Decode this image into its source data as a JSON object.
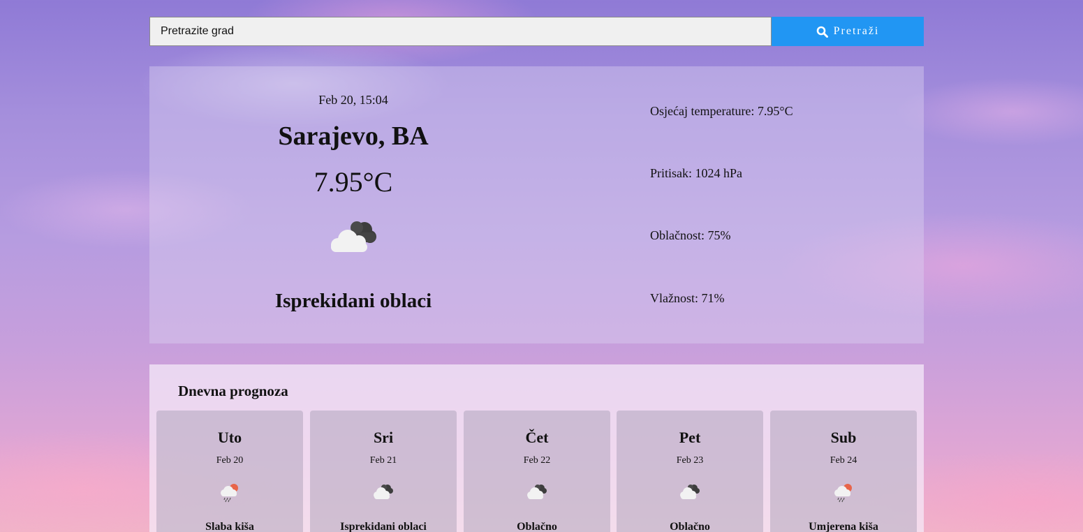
{
  "search": {
    "placeholder": "Pretrazite grad",
    "button_label": "Pretraži"
  },
  "current": {
    "date": "Feb 20, 15:04",
    "city": "Sarajevo, BA",
    "temperature": "7.95°C",
    "icon": "broken-clouds-icon",
    "description": "Isprekidani oblaci",
    "details": {
      "feels_like": "Osjećaj temperature: 7.95°C",
      "pressure": "Pritisak: 1024 hPa",
      "cloudiness": "Oblačnost: 75%",
      "humidity": "Vlažnost: 71%"
    }
  },
  "forecast": {
    "title": "Dnevna prognoza",
    "days": [
      {
        "day": "Uto",
        "date": "Feb 20",
        "icon": "light-rain-icon",
        "description": "Slaba kiša"
      },
      {
        "day": "Sri",
        "date": "Feb 21",
        "icon": "broken-clouds-icon",
        "description": "Isprekidani oblaci"
      },
      {
        "day": "Čet",
        "date": "Feb 22",
        "icon": "overcast-clouds-icon",
        "description": "Oblačno"
      },
      {
        "day": "Pet",
        "date": "Feb 23",
        "icon": "overcast-clouds-icon",
        "description": "Oblačno"
      },
      {
        "day": "Sub",
        "date": "Feb 24",
        "icon": "moderate-rain-icon",
        "description": "Umjerena kiša"
      }
    ]
  },
  "colors": {
    "search_button": "#2196f3",
    "input_background": "#f0f0f0",
    "rain_sun": "#e8654a"
  }
}
